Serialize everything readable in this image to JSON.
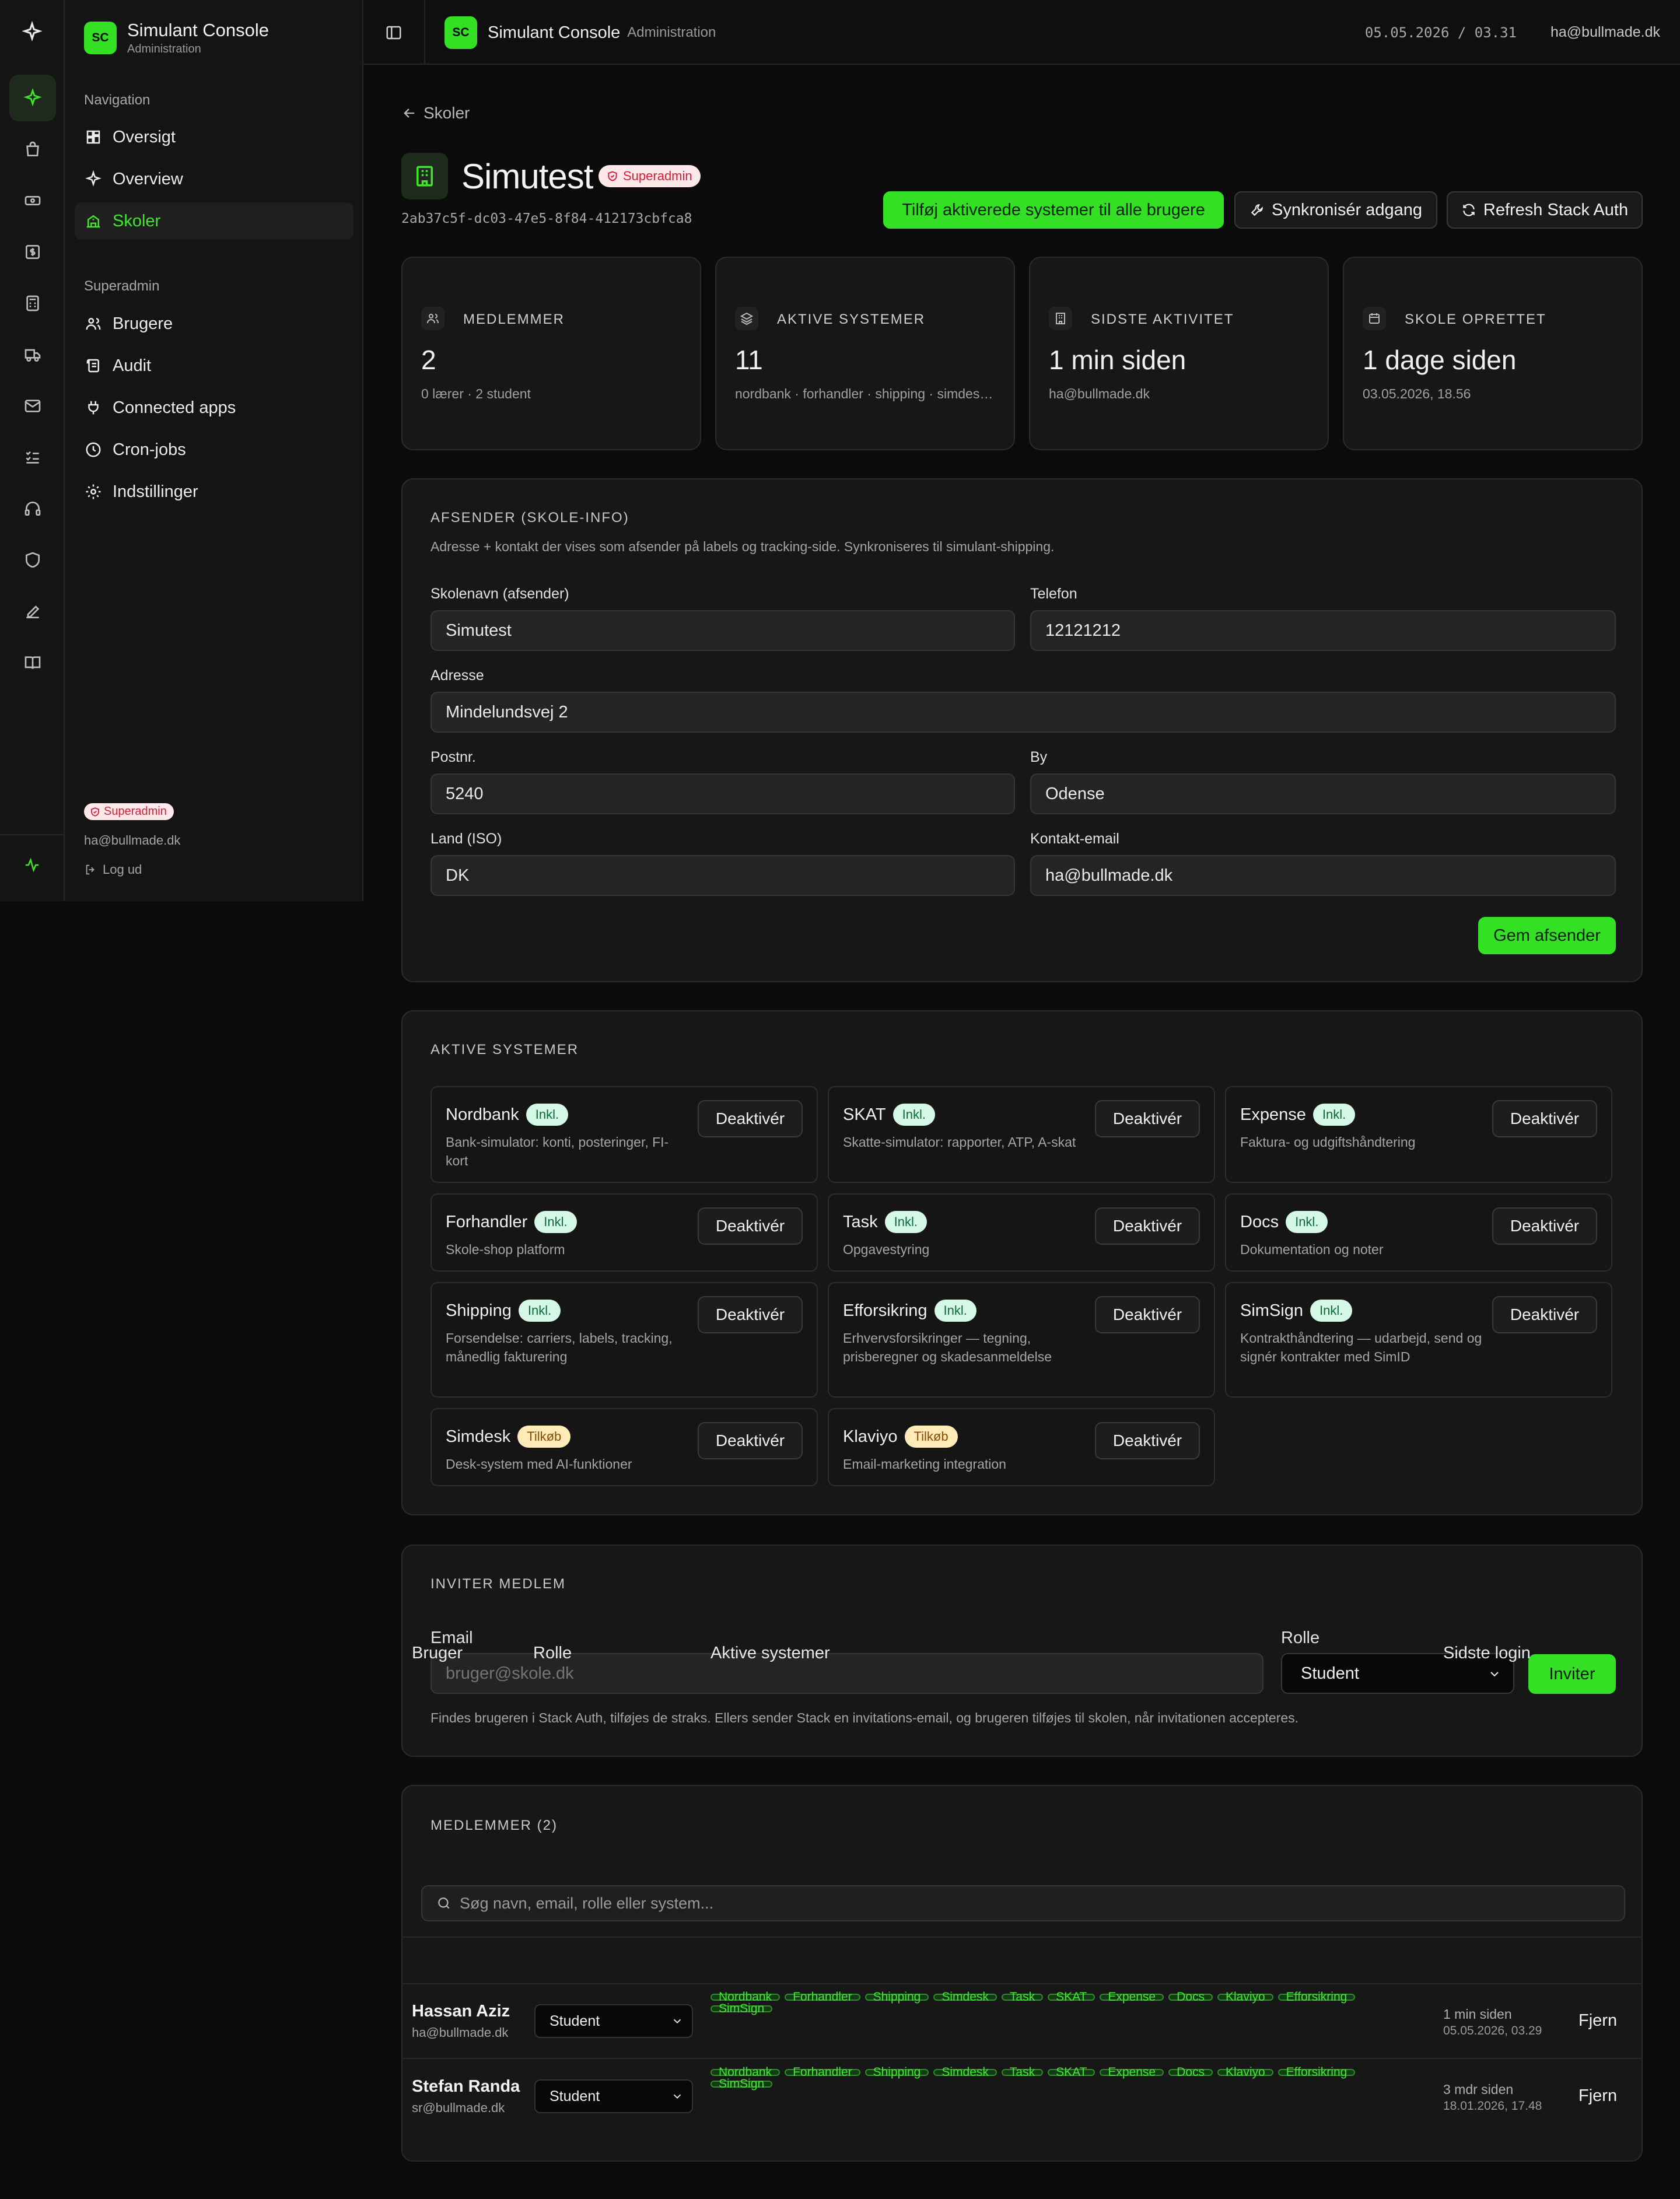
{
  "app": {
    "logo": "SC",
    "name": "Simulant Console",
    "subtitle": "Administration"
  },
  "topbar": {
    "datetime": "05.05.2026 / 03.31",
    "user": "ha@bullmade.dk"
  },
  "sidebar": {
    "nav_heading": "Navigation",
    "nav_items": [
      {
        "label": "Oversigt",
        "icon": "dashboard-icon"
      },
      {
        "label": "Overview",
        "icon": "sparkle-icon"
      },
      {
        "label": "Skoler",
        "icon": "school-icon",
        "active": true
      }
    ],
    "super_heading": "Superadmin",
    "super_items": [
      {
        "label": "Brugere",
        "icon": "users-icon"
      },
      {
        "label": "Audit",
        "icon": "scroll-icon"
      },
      {
        "label": "Connected apps",
        "icon": "plug-icon"
      },
      {
        "label": "Cron-jobs",
        "icon": "clock-icon"
      },
      {
        "label": "Indstillinger",
        "icon": "gear-icon"
      }
    ],
    "role_badge": "Superadmin",
    "email": "ha@bullmade.dk",
    "logout": "Log ud"
  },
  "rail_icons": [
    "sparkle-icon",
    "bag-icon",
    "ticket-icon",
    "dollar-icon",
    "calculator-icon",
    "truck-icon",
    "mail-icon",
    "checklist-icon",
    "headset-icon",
    "shield-icon",
    "pen-icon",
    "book-icon"
  ],
  "page": {
    "back": "Skoler",
    "title": "Simutest",
    "badge": "Superadmin",
    "uuid": "2ab37c5f-dc03-47e5-8f84-412173cbfca8",
    "actions": {
      "add_all": "Tilføj aktiverede systemer til alle brugere",
      "sync": "Synkronisér adgang",
      "refresh": "Refresh Stack Auth"
    }
  },
  "stats": [
    {
      "label": "MEDLEMMER",
      "value": "2",
      "sub": "0 lærer · 2 student",
      "icon": "users-icon"
    },
    {
      "label": "AKTIVE SYSTEMER",
      "value": "11",
      "sub": "nordbank · forhandler · shipping · simdesk · task",
      "icon": "layers-icon"
    },
    {
      "label": "SIDSTE AKTIVITET",
      "value": "1 min siden",
      "sub": "ha@bullmade.dk",
      "icon": "building-icon"
    },
    {
      "label": "SKOLE OPRETTET",
      "value": "1 dage siden",
      "sub": "03.05.2026, 18.56",
      "icon": "calendar-icon"
    }
  ],
  "sender": {
    "heading": "AFSENDER (SKOLE-INFO)",
    "desc": "Adresse + kontakt der vises som afsender på labels og tracking-side. Synkroniseres til simulant-shipping.",
    "fields": {
      "name_label": "Skolenavn (afsender)",
      "name": "Simutest",
      "phone_label": "Telefon",
      "phone": "12121212",
      "address_label": "Adresse",
      "address": "Mindelundsvej 2",
      "zip_label": "Postnr.",
      "zip": "5240",
      "city_label": "By",
      "city": "Odense",
      "country_label": "Land (ISO)",
      "country": "DK",
      "email_label": "Kontakt-email",
      "email": "ha@bullmade.dk"
    },
    "save": "Gem afsender"
  },
  "systems": {
    "heading": "AKTIVE SYSTEMER",
    "deactivate": "Deaktivér",
    "items": [
      {
        "name": "Nordbank",
        "badge": "Inkl.",
        "type": "incl",
        "desc": "Bank-simulator: konti, posteringer, FI-kort"
      },
      {
        "name": "SKAT",
        "badge": "Inkl.",
        "type": "incl",
        "desc": "Skatte-simulator: rapporter, ATP, A-skat"
      },
      {
        "name": "Expense",
        "badge": "Inkl.",
        "type": "incl",
        "desc": "Faktura- og udgiftshåndtering"
      },
      {
        "name": "Forhandler",
        "badge": "Inkl.",
        "type": "incl",
        "desc": "Skole-shop platform"
      },
      {
        "name": "Task",
        "badge": "Inkl.",
        "type": "incl",
        "desc": "Opgavestyring"
      },
      {
        "name": "Docs",
        "badge": "Inkl.",
        "type": "incl",
        "desc": "Dokumentation og noter"
      },
      {
        "name": "Shipping",
        "badge": "Inkl.",
        "type": "incl",
        "desc": "Forsendelse: carriers, labels, tracking, månedlig fakturering"
      },
      {
        "name": "Efforsikring",
        "badge": "Inkl.",
        "type": "incl",
        "desc": "Erhvervsforsikringer — tegning, prisberegner og skadesanmeldelse"
      },
      {
        "name": "SimSign",
        "badge": "Inkl.",
        "type": "incl",
        "desc": "Kontrakthåndtering — udarbejd, send og signér kontrakter med SimID"
      },
      {
        "name": "Simdesk",
        "badge": "Tilkøb",
        "type": "addon",
        "desc": "Desk-system med AI-funktioner"
      },
      {
        "name": "Klaviyo",
        "badge": "Tilkøb",
        "type": "addon",
        "desc": "Email-marketing integration"
      }
    ]
  },
  "invite": {
    "heading": "INVITER MEDLEM",
    "email_label": "Email",
    "email_placeholder": "bruger@skole.dk",
    "role_label": "Rolle",
    "role": "Student",
    "button": "Inviter",
    "note": "Findes brugeren i Stack Auth, tilføjes de straks. Ellers sender Stack en invitations-email, og brugeren tilføjes til skolen, når invitationen accepteres."
  },
  "members": {
    "heading": "MEDLEMMER (2)",
    "search_placeholder": "Søg navn, email, rolle eller system...",
    "columns": {
      "user": "Bruger",
      "role": "Rolle",
      "systems": "Aktive systemer",
      "last": "Sidste login"
    },
    "remove": "Fjern",
    "rows": [
      {
        "name": "Hassan Aziz",
        "email": "ha@bullmade.dk",
        "role": "Student",
        "systems": [
          "Nordbank",
          "Forhandler",
          "Shipping",
          "Simdesk",
          "Task",
          "SKAT",
          "Expense",
          "Docs",
          "Klaviyo",
          "Efforsikring",
          "SimSign"
        ],
        "last": "1 min siden",
        "last_date": "05.05.2026, 03.29"
      },
      {
        "name": "Stefan Randa",
        "email": "sr@bullmade.dk",
        "role": "Student",
        "systems": [
          "Nordbank",
          "Forhandler",
          "Shipping",
          "Simdesk",
          "Task",
          "SKAT",
          "Expense",
          "Docs",
          "Klaviyo",
          "Efforsikring",
          "SimSign"
        ],
        "last": "3 mdr siden",
        "last_date": "18.01.2026, 17.48"
      }
    ]
  },
  "colors": {
    "accent": "#34e024",
    "background": "#0b0b0b",
    "card": "#171717",
    "superadmin_badge": "#ffe8ea",
    "incl_badge": "#d5f7e6",
    "addon_badge": "#ffebb8"
  }
}
